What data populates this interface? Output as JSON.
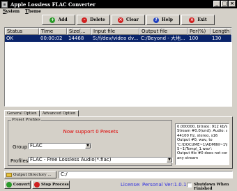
{
  "window": {
    "title": "Apple Lossless FLAC Converter",
    "min": "_",
    "max": "□",
    "close": "×"
  },
  "menu": [
    {
      "accel": "S",
      "rest": "ystem"
    },
    {
      "accel": "T",
      "rest": "heme"
    }
  ],
  "toolbar": {
    "add": "Add",
    "delete": "Delete",
    "clear": "Clear",
    "help": "Help",
    "exit": "Exit"
  },
  "table": {
    "columns": [
      "Status",
      "Time",
      "Size(...",
      "Input file",
      "Output file",
      "Per(%)",
      "Length"
    ],
    "rows": [
      [
        "OK",
        "00:00:02",
        "14468",
        "S:/f/dev/video dv...",
        "C:/Beyond - 大地...",
        "100",
        "130"
      ]
    ]
  },
  "tabs": {
    "general": "General Option",
    "advanced": "Advanced Option"
  },
  "presets": {
    "legend": "Preset Profiles",
    "support_text": "Now support 0 Presets",
    "group_label": "Group:",
    "group_value": "FLAC",
    "profiles_label": "Profiles:",
    "profiles_value": "FLAC - Free Lossless Audio(*.flac)"
  },
  "log_lines": [
    "0.000000, bitrate: 912 kb/s",
    "    Stream #0.0(und): Audio: alac,",
    "44100 Hz, stereo, s16",
    "Output #0, wav, to",
    "'C:\\DOCUME~1\\ADMINI~1\\LOCAL",
    "S~1\\Temp\\_1.wav':",
    "Output file #0 does not contain",
    "any stream"
  ],
  "output": {
    "button": "Output Directory ...",
    "path": "C:/"
  },
  "bottom": {
    "convert": "Convert",
    "stop": "Stop Process",
    "license": "License: Personal Ver:1.0.1",
    "shutdown": "Shutdown When Finished"
  },
  "colors": {
    "selection": "#0a246a",
    "red_text": "#e00000",
    "license_blue": "#3030e0"
  }
}
